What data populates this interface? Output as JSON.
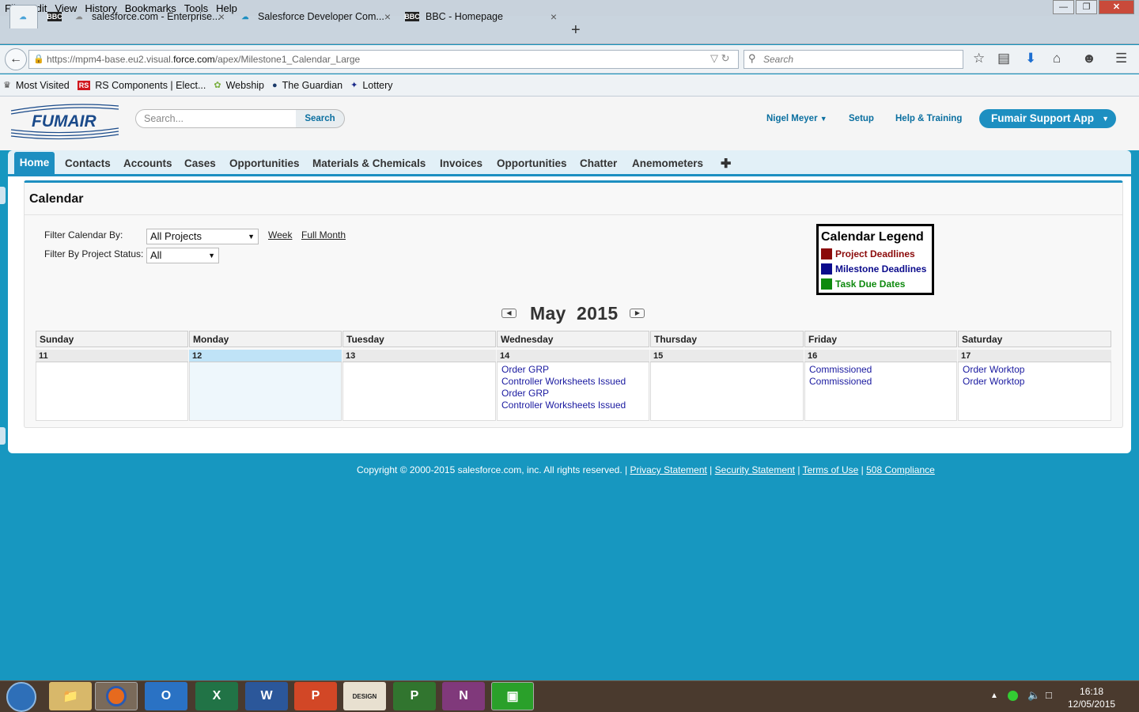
{
  "browser": {
    "menu": [
      "File",
      "Edit",
      "View",
      "History",
      "Bookmarks",
      "Tools",
      "Help"
    ],
    "tabs": [
      {
        "label": "salesforce.com - Enterprise...",
        "fav": "cloud"
      },
      {
        "label": "Salesforce Developer Com...",
        "fav": "cloud"
      },
      {
        "label": "BBC - Homepage",
        "fav": "BBC"
      }
    ],
    "url_prefix": "https://mpm4-base.eu2.visual.",
    "url_domain": "force.com",
    "url_suffix": "/apex/Milestone1_Calendar_Large",
    "search_placeholder": "Search",
    "bookmarks": [
      {
        "label": "Most Visited",
        "icon": "bookmark-icon"
      },
      {
        "label": "RS Components | Elect...",
        "icon": "RS"
      },
      {
        "label": "Webship",
        "icon": "webship-icon"
      },
      {
        "label": "The Guardian",
        "icon": "guardian-icon"
      },
      {
        "label": "Lottery",
        "icon": "lottery-icon"
      }
    ]
  },
  "sf": {
    "logo_text": "FUMAIR",
    "search_placeholder": "Search...",
    "search_button": "Search",
    "user": "Nigel Meyer",
    "setup": "Setup",
    "help": "Help & Training",
    "app": "Fumair Support App",
    "tabs": [
      "Home",
      "Contacts",
      "Accounts",
      "Cases",
      "Opportunities",
      "Materials & Chemicals",
      "Invoices",
      "Opportunities",
      "Chatter",
      "Anemometers"
    ]
  },
  "calendar": {
    "title": "Calendar",
    "filter_by_label": "Filter Calendar By:",
    "filter_by_value": "All Projects",
    "week_link": "Week",
    "month_link": "Full Month",
    "status_label": "Filter By Project Status:",
    "status_value": "All",
    "legend": {
      "title": "Calendar Legend",
      "items": [
        {
          "label": "Project Deadlines",
          "color": "#8b0a0a"
        },
        {
          "label": "Milestone Deadlines",
          "color": "#0b0b8c"
        },
        {
          "label": "Task Due Dates",
          "color": "#0e8a0e"
        }
      ]
    },
    "month": "May",
    "year": "2015",
    "days": [
      {
        "name": "Sunday",
        "num": "11",
        "events": []
      },
      {
        "name": "Monday",
        "num": "12",
        "events": [],
        "today": true
      },
      {
        "name": "Tuesday",
        "num": "13",
        "events": []
      },
      {
        "name": "Wednesday",
        "num": "14",
        "events": [
          "Order GRP",
          "Controller Worksheets Issued",
          "Order GRP",
          "Controller Worksheets Issued"
        ]
      },
      {
        "name": "Thursday",
        "num": "15",
        "events": []
      },
      {
        "name": "Friday",
        "num": "16",
        "events": [
          "Commissioned",
          "Commissioned"
        ]
      },
      {
        "name": "Saturday",
        "num": "17",
        "events": [
          "Order Worktop",
          "Order Worktop"
        ]
      }
    ]
  },
  "footer": {
    "copyright": "Copyright © 2000-2015 salesforce.com, inc. All rights reserved. |",
    "links": [
      "Privacy Statement",
      "Security Statement",
      "Terms of Use",
      "508 Compliance"
    ]
  },
  "taskbar": {
    "apps": [
      "explorer",
      "firefox",
      "outlook",
      "excel",
      "word",
      "powerpoint",
      "design",
      "project",
      "onenote",
      "app"
    ],
    "time": "16:18",
    "date": "12/05/2015"
  }
}
